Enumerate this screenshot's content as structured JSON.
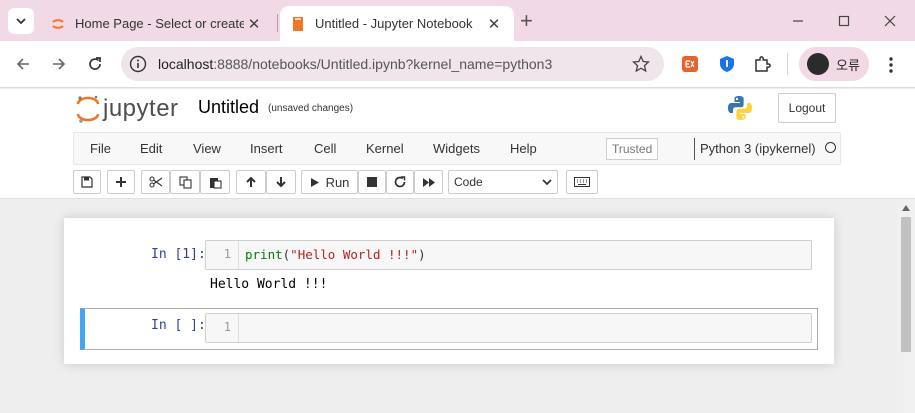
{
  "browser": {
    "tabs": [
      {
        "title": "Home Page - Select or create",
        "active": false
      },
      {
        "title": "Untitled - Jupyter Notebook",
        "active": true
      }
    ],
    "url_host": "localhost",
    "url_rest": ":8888/notebooks/Untitled.ipynb?kernel_name=python3",
    "profile_name": "오류",
    "colors": {
      "tabbar": "#f2d9e6",
      "omnibox": "#efe5ea"
    }
  },
  "jupyter": {
    "logo_text": "jupyter",
    "notebook_name": "Untitled",
    "save_state": "(unsaved changes)",
    "logout_label": "Logout",
    "menus": [
      "File",
      "Edit",
      "View",
      "Insert",
      "Cell",
      "Kernel",
      "Widgets",
      "Help"
    ],
    "trusted_label": "Trusted",
    "kernel_name": "Python 3 (ipykernel)",
    "run_label": "Run",
    "cell_type": "Code"
  },
  "cells": [
    {
      "prompt": "In [1]:",
      "line_number": "1",
      "code_func": "print",
      "code_open": "(",
      "code_string": "\"Hello World !!!\"",
      "code_close": ")",
      "output": "Hello World !!!"
    },
    {
      "prompt": "In [ ]:",
      "line_number": "1",
      "selected": true
    }
  ]
}
